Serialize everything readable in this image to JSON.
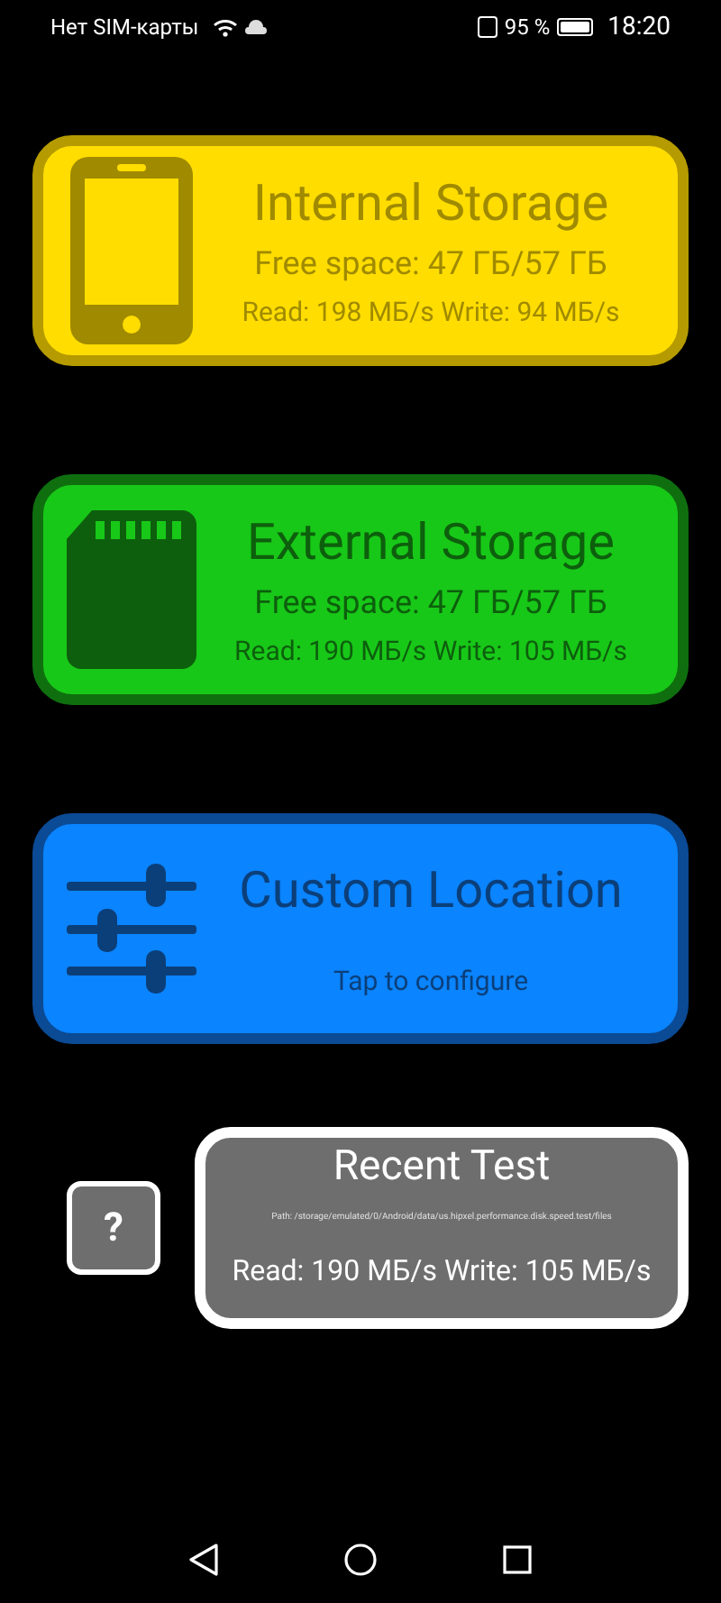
{
  "status_bar": {
    "carrier": "Нет SIM-карты",
    "battery": "95 %",
    "time": "18:20"
  },
  "cards": [
    {
      "kind": "phone",
      "title": "Internal Storage",
      "lines": [
        "Free space: 47 ГБ/57 ГБ",
        "Read: 198 МБ/s Write: 94 МБ/s"
      ]
    },
    {
      "kind": "sdcard",
      "title": "External Storage",
      "lines": [
        "Free space: 47 ГБ/57 ГБ",
        "Read: 190 МБ/s Write: 105 МБ/s"
      ]
    },
    {
      "kind": "sliders",
      "title": "Custom Location",
      "lines": [
        "Tap to configure"
      ]
    }
  ],
  "help_button": "?",
  "recent_test": {
    "title": "Recent Test",
    "path": "Path: /storage/emulated/0/Android/data/us.hipxel.performance.disk.speed.test/files",
    "result": "Read: 190 МБ/s Write: 105 МБ/s"
  }
}
